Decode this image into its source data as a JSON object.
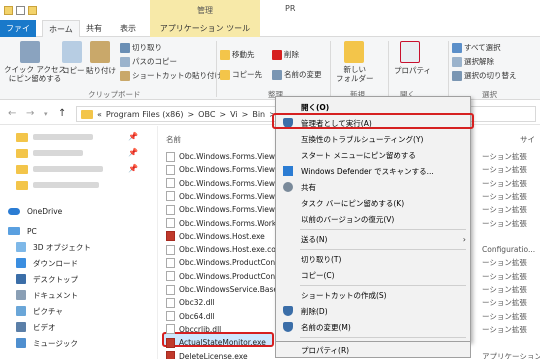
{
  "window": {
    "title": "PR",
    "context_header": "管理"
  },
  "tabs": [
    "ファイル",
    "ホーム",
    "共有",
    "表示",
    "アプリケーション ツール"
  ],
  "ribbon": {
    "pin_label": "クイック アクセス\nにピン留めする",
    "copy": "コピー",
    "paste": "貼り付け",
    "cut": "切り取り",
    "copy_path": "パスのコピー",
    "paste_shortcut": "ショートカットの貼り付け",
    "clipboard_group": "クリップボード",
    "move_to": "移動先",
    "copy_to": "コピー先",
    "delete": "削除",
    "rename": "名前の変更",
    "organize_group": "整理",
    "new_folder": "新しい\nフォルダー",
    "new_group": "新規",
    "properties": "プロパティ",
    "open_group": "開く",
    "select_all": "すべて選択",
    "select_none": "選択解除",
    "invert_selection": "選択の切り替え",
    "select_group": "選択"
  },
  "address": {
    "path": [
      "«",
      "Program Files (x86)",
      ">",
      "OBC",
      ">",
      "Vi",
      ">",
      "Bin",
      ">"
    ]
  },
  "nav": {
    "onedrive": "OneDrive",
    "pc": "PC",
    "items": [
      "3D オブジェクト",
      "ダウンロード",
      "デスクトップ",
      "ドキュメント",
      "ピクチャ",
      "ビデオ",
      "ミュージック"
    ]
  },
  "content": {
    "col_name": "名前",
    "col_type": "サイ",
    "files": [
      "Obc.Windows.Forms.View.H",
      "Obc.Windows.Forms.View.I",
      "Obc.Windows.Forms.View.I",
      "Obc.Windows.Forms.View.I",
      "Obc.Windows.Forms.View.S",
      "Obc.Windows.Forms.Workf",
      "Obc.Windows.Host.exe",
      "Obc.Windows.Host.exe.cor",
      "Obc.Windows.ProductConn",
      "Obc.Windows.ProductConn",
      "Obc.WindowsService.BaseC",
      "Obc32.dll",
      "Obc64.dll",
      "Obccrlib.dll",
      "ActualStateMonitor.exe",
      "DeleteLicense.exe"
    ],
    "types": [
      "ーション拡張",
      "ーション拡張",
      "ーション拡張",
      "ーション拡張",
      "ーション拡張",
      "ーション拡張",
      "",
      "Configuratio...",
      "ーション拡張",
      "ーション拡張",
      "ーション拡張",
      "ーション拡張",
      "ーション拡張",
      "ーション拡張",
      "",
      "アプリケーション"
    ]
  },
  "context_menu": {
    "items": [
      "開く(O)",
      "管理者として実行(A)",
      "互換性のトラブルシューティング(Y)",
      "スタート メニューにピン留めする",
      "Windows Defender でスキャンする...",
      "共有",
      "タスク バーにピン留めする(K)",
      "以前のバージョンの復元(V)",
      "送る(N)",
      "切り取り(T)",
      "コピー(C)",
      "ショートカットの作成(S)",
      "削除(D)",
      "名前の変更(M)",
      "プロパティ(R)"
    ]
  }
}
